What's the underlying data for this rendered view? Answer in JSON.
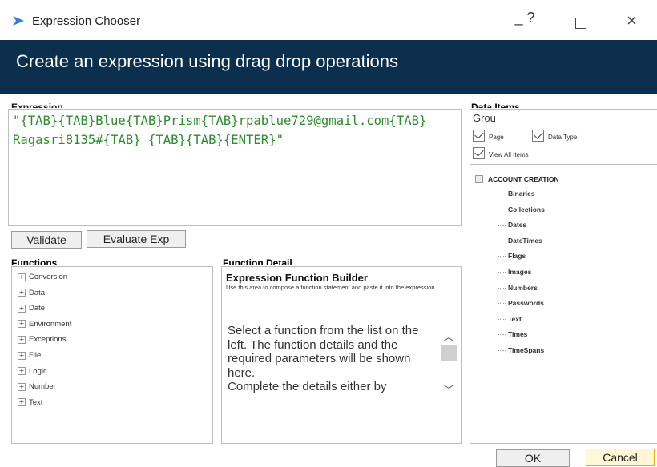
{
  "window": {
    "title": "Expression Chooser",
    "minimize_label": "_ ?",
    "close_label": "×"
  },
  "header": {
    "title": "Create an expression using drag drop operations"
  },
  "expression": {
    "label": "Expression",
    "value": "\"{TAB}{TAB}Blue{TAB}Prism{TAB}rpablue729@gmail.com{TAB}Ragasri8135#{TAB} {TAB}{TAB}{ENTER}\""
  },
  "buttons": {
    "validate": "Validate",
    "evaluate": "Evaluate Exp",
    "ok": "OK",
    "cancel": "Cancel"
  },
  "functions": {
    "label": "Functions",
    "items": [
      "Conversion",
      "Data",
      "Date",
      "Environment",
      "Exceptions",
      "File",
      "Logic",
      "Number",
      "Text"
    ]
  },
  "function_detail": {
    "label": "Function Detail",
    "title": "Expression Function Builder",
    "subtitle": "Use this area to compose a function statement and paste it into the expression.",
    "body": "Select a function from the list on the left. The function details and the required parameters will be shown here.\nComplete the details either by"
  },
  "data_items": {
    "label": "Data Items",
    "group_value": "Grou",
    "checkboxes": {
      "page": "Page",
      "data_type": "Data Type",
      "view_all": "View All Items"
    },
    "root": "ACCOUNT CREATION",
    "items": [
      "Binaries",
      "Collections",
      "Dates",
      "DateTimes",
      "Flags",
      "Images",
      "Numbers",
      "Passwords",
      "Text",
      "Times",
      "TimeSpans"
    ]
  },
  "colors": {
    "header_bg": "#0c2f4d",
    "expression_text": "#2e8b2e",
    "app_icon": "#2f7fd6"
  }
}
